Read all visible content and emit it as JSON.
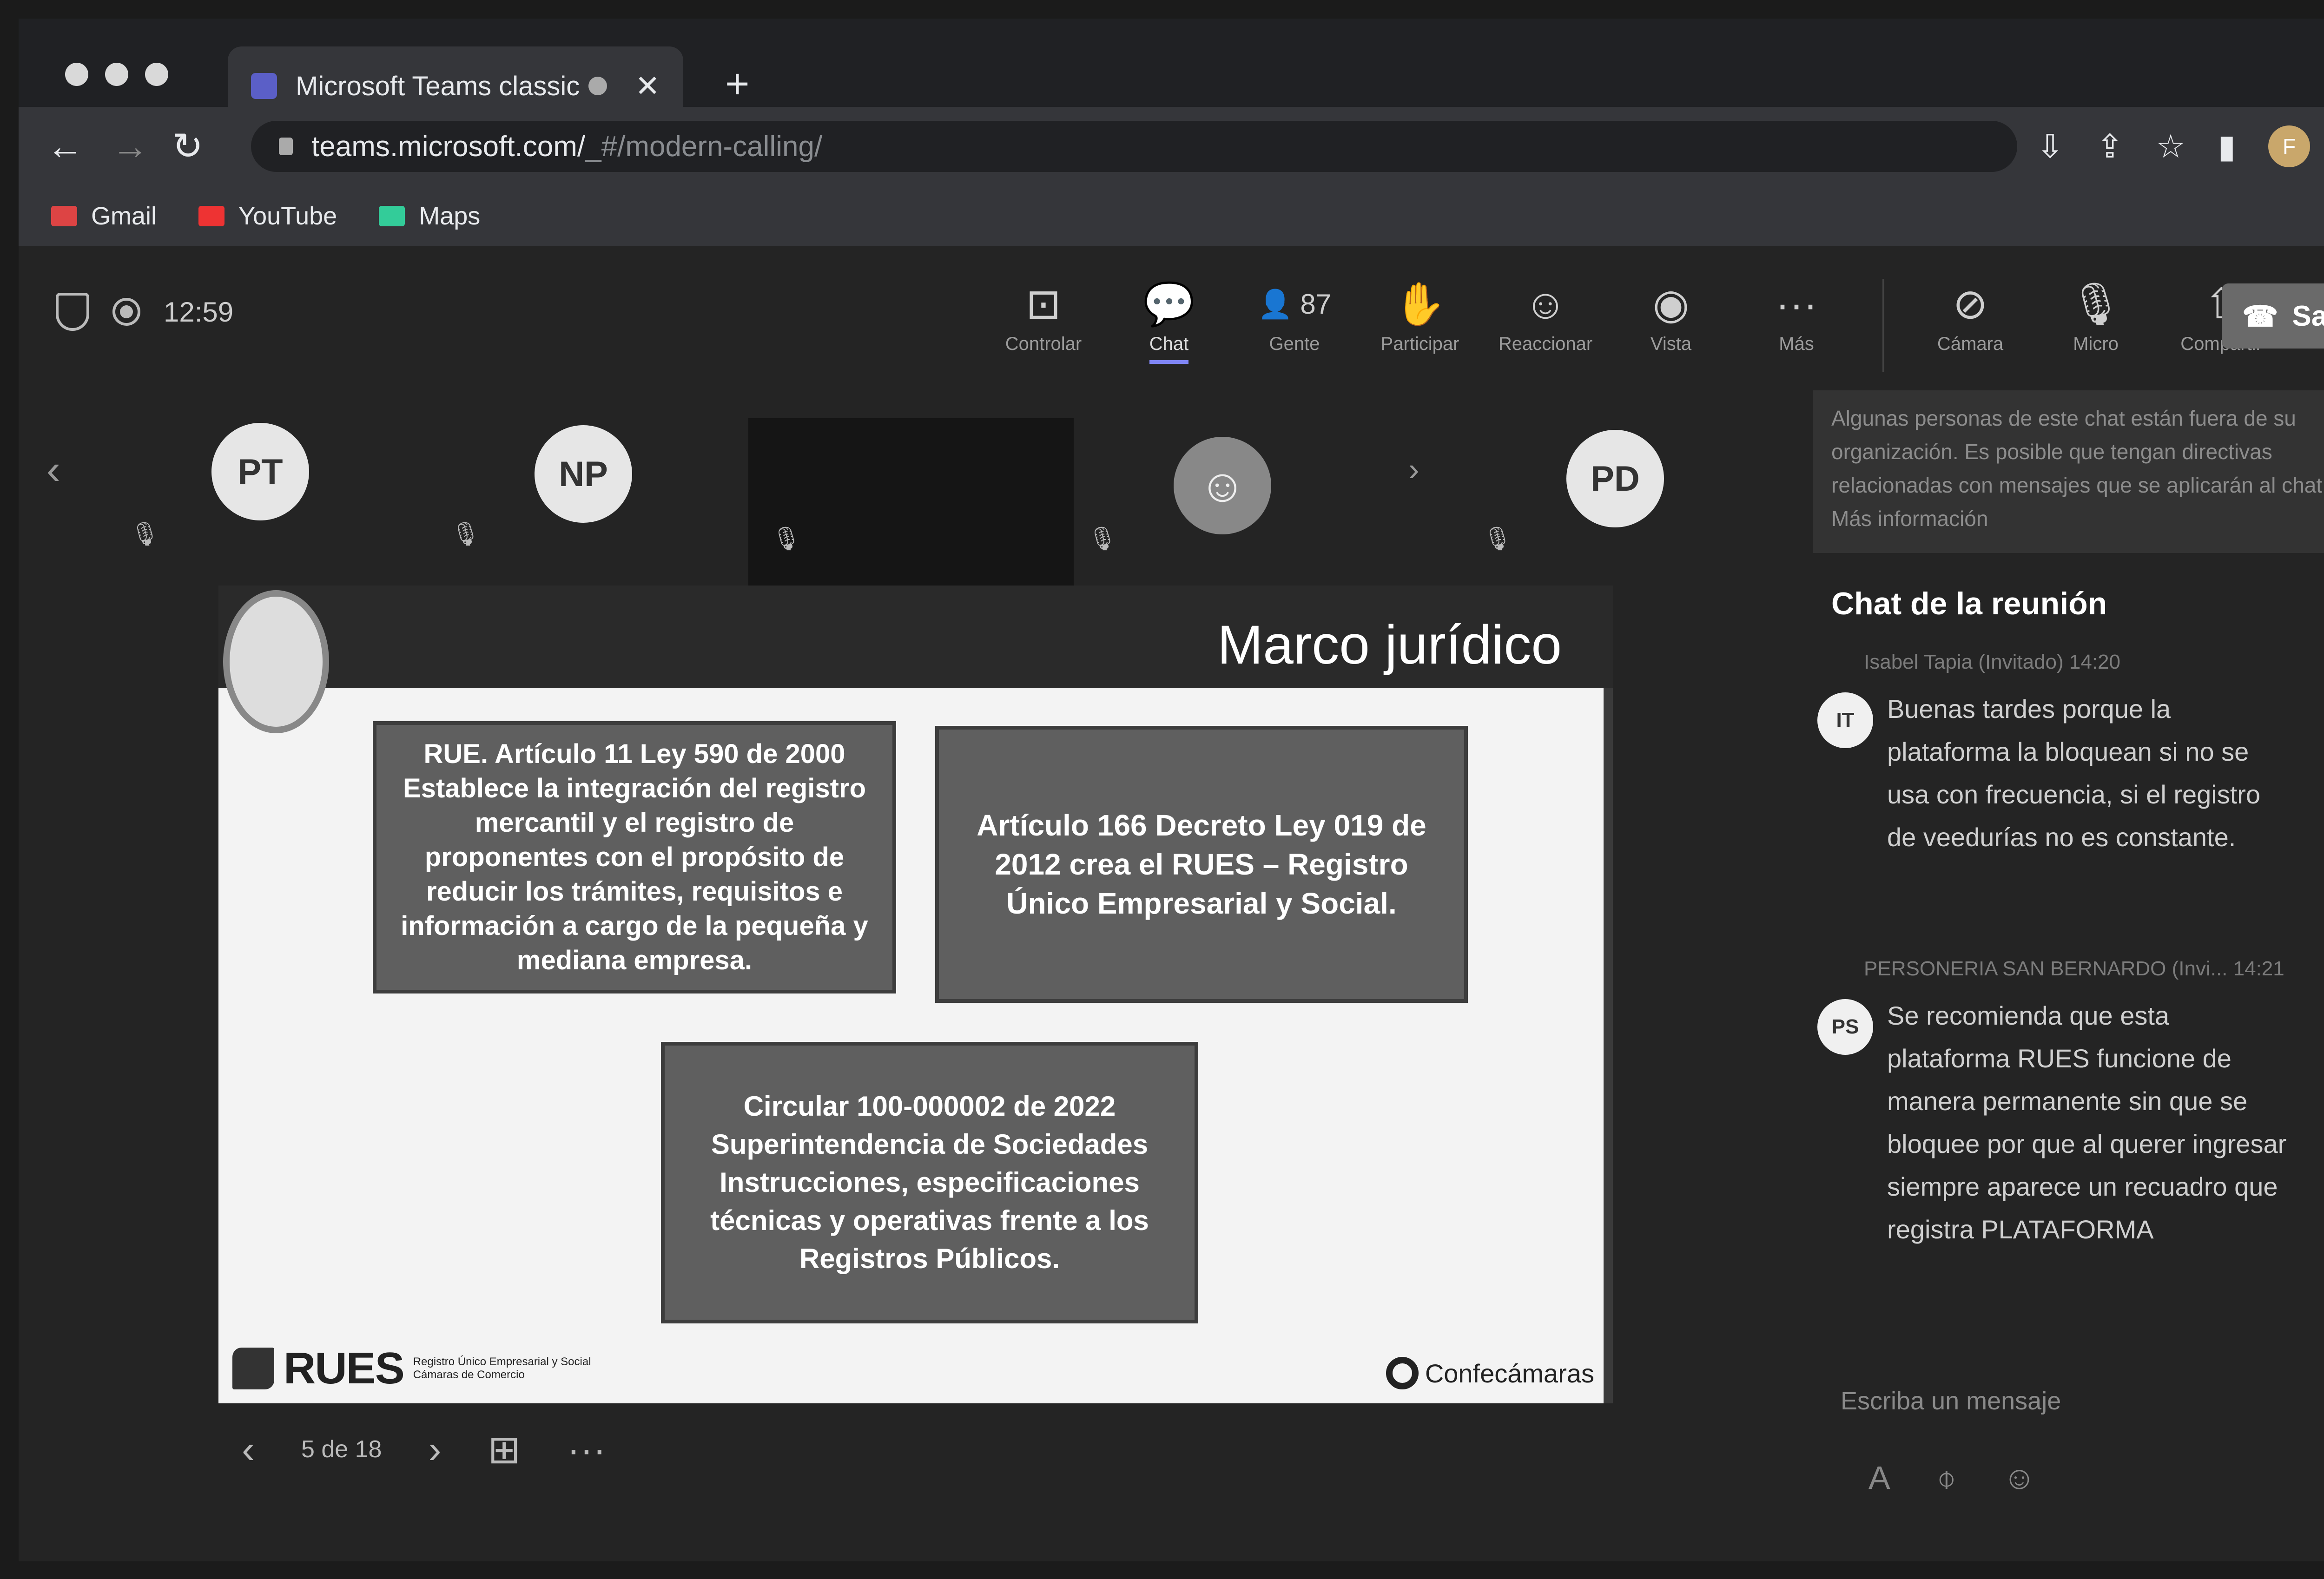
{
  "browser": {
    "tab_title": "Microsoft Teams classic",
    "tab_close": "✕",
    "new_tab": "+",
    "url_host": "teams.microsoft.com/",
    "url_path": "_#/modern-calling/",
    "bookmarks": [
      {
        "label": "Gmail",
        "icon": "gmail-icon"
      },
      {
        "label": "YouTube",
        "icon": "youtube-icon"
      },
      {
        "label": "Maps",
        "icon": "maps-icon"
      }
    ],
    "profile_initial": "F"
  },
  "meeting": {
    "timer": "12:59",
    "toolbar": [
      {
        "icon": "⊡",
        "label": "Controlar"
      },
      {
        "icon": "💬",
        "label": "Chat"
      },
      {
        "icon": "👤 87",
        "label": "Gente"
      },
      {
        "icon": "✋",
        "label": "Participar"
      },
      {
        "icon": "☺",
        "label": "Reaccionar"
      },
      {
        "icon": "◉",
        "label": "Vista"
      },
      {
        "icon": "···",
        "label": "Más"
      }
    ],
    "controls": [
      {
        "icon": "⊘",
        "label": "Cámara"
      },
      {
        "icon": "🎙",
        "label": "Micro"
      },
      {
        "icon": "⇧",
        "label": "Compartir"
      }
    ],
    "leave_label": "Salir",
    "participants": [
      "PT",
      "NP",
      "PD"
    ],
    "notice": "Algunas personas de este chat están fuera de su organización. Es posible que tengan directivas relacionadas con mensajes que se aplicarán al chat. Más información"
  },
  "slide": {
    "title": "Marco jurídico",
    "box1": "RUE. Artículo 11 Ley 590 de 2000 Establece la integración del registro mercantil y el registro de proponentes con el propósito de reducir los trámites, requisitos e información a cargo de la pequeña y mediana empresa.",
    "box2": "Artículo 166 Decreto Ley 019 de 2012 crea el RUES – Registro Único Empresarial y Social.",
    "box3": "Circular 100-000002 de 2022 Superintendencia de Sociedades Instrucciones, especificaciones técnicas y operativas frente a los Registros Públicos.",
    "rues_logo": "RUES",
    "rues_sub": "Registro Único Empresarial y Social Cámaras de Comercio",
    "confe_logo": "Confecámaras",
    "page": "5 de 18"
  },
  "chat": {
    "title": "Chat de la reunión",
    "messages": [
      {
        "author_meta": "Isabel Tapia (Invitado)  14:20",
        "initials": "IT",
        "text": "Buenas tardes porque la plataforma la bloquean si no se usa con frecuencia, si el registro de veedurías no es constante."
      },
      {
        "author_meta": "PERSONERIA SAN BERNARDO (Invi...  14:21",
        "initials": "PS",
        "text": "Se recomienda que esta plataforma RUES funcione de manera permanente sin que se bloquee por que al querer ingresar siempre aparece un recuadro que registra PLATAFORMA"
      }
    ],
    "compose_placeholder": "Escriba un mensaje"
  }
}
